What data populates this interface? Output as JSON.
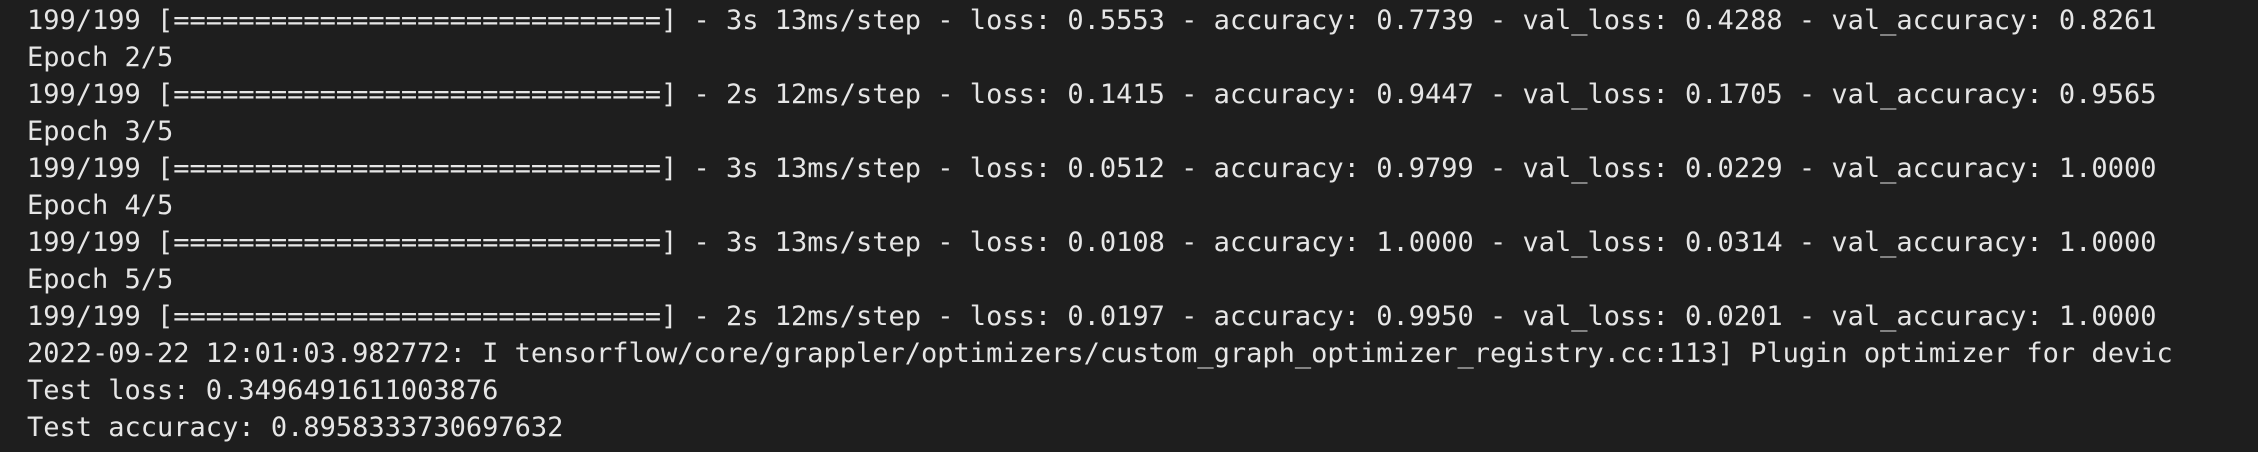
{
  "terminal": {
    "lines": [
      "199/199 [==============================] - 3s 13ms/step - loss: 0.5553 - accuracy: 0.7739 - val_loss: 0.4288 - val_accuracy: 0.8261",
      "Epoch 2/5",
      "199/199 [==============================] - 2s 12ms/step - loss: 0.1415 - accuracy: 0.9447 - val_loss: 0.1705 - val_accuracy: 0.9565",
      "Epoch 3/5",
      "199/199 [==============================] - 3s 13ms/step - loss: 0.0512 - accuracy: 0.9799 - val_loss: 0.0229 - val_accuracy: 1.0000",
      "Epoch 4/5",
      "199/199 [==============================] - 3s 13ms/step - loss: 0.0108 - accuracy: 1.0000 - val_loss: 0.0314 - val_accuracy: 1.0000",
      "Epoch 5/5",
      "199/199 [==============================] - 2s 12ms/step - loss: 0.0197 - accuracy: 0.9950 - val_loss: 0.0201 - val_accuracy: 1.0000",
      "2022-09-22 12:01:03.982772: I tensorflow/core/grappler/optimizers/custom_graph_optimizer_registry.cc:113] Plugin optimizer for devic",
      "Test loss: 0.3496491611003876",
      "Test accuracy: 0.8958333730697632"
    ]
  },
  "colors": {
    "background": "#1e1e1e",
    "text": "#e6e6e6"
  }
}
